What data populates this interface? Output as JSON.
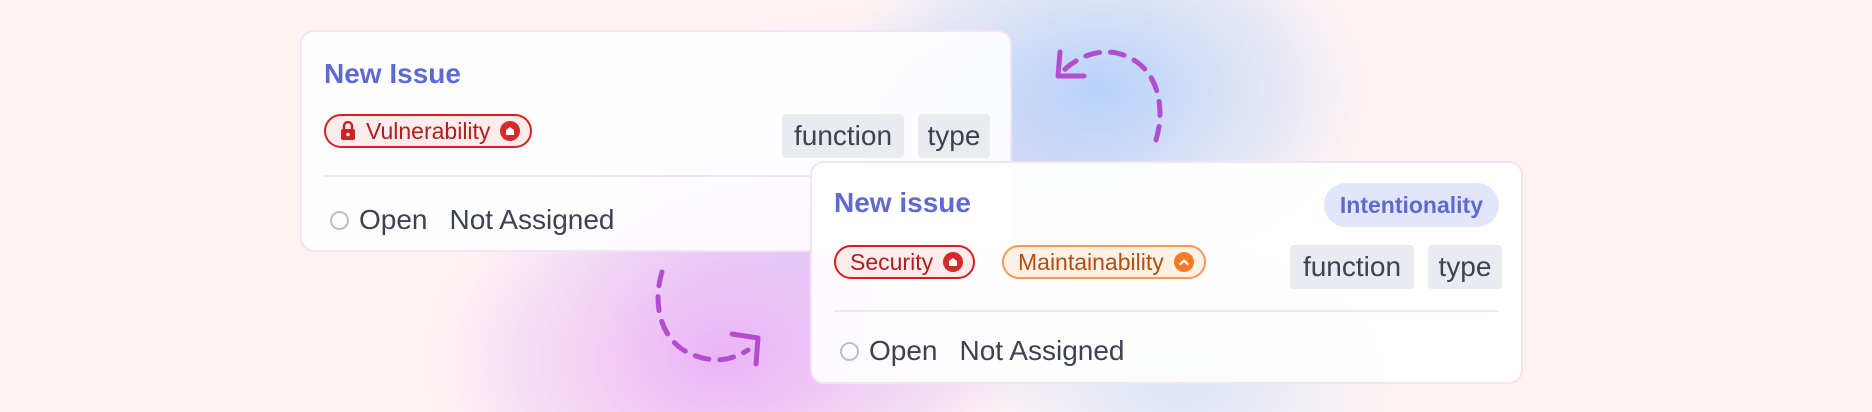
{
  "card_back": {
    "title": "New Issue",
    "tags": [
      {
        "label": "Vulnerability",
        "icon": "lock-icon",
        "color": "#d32121"
      }
    ],
    "chips": [
      "function",
      "type"
    ],
    "status": "Open",
    "assignee": "Not Assigned"
  },
  "card_front": {
    "title": "New issue",
    "badge": "Intentionality",
    "tags": [
      {
        "label": "Security",
        "color": "#d32121"
      },
      {
        "label": "Maintainability",
        "color": "#f57a2a"
      }
    ],
    "chips": [
      "function",
      "type"
    ],
    "status": "Open",
    "assignee": "Not Assigned"
  },
  "colors": {
    "accent": "#5e6ad2",
    "arrow": "#b44ccf",
    "tag_red": "#d32121",
    "tag_orange": "#f57a2a"
  },
  "icons": [
    "lock-icon",
    "severity-high-icon",
    "severity-medium-icon",
    "status-open-icon",
    "swap-arrow-icon"
  ]
}
